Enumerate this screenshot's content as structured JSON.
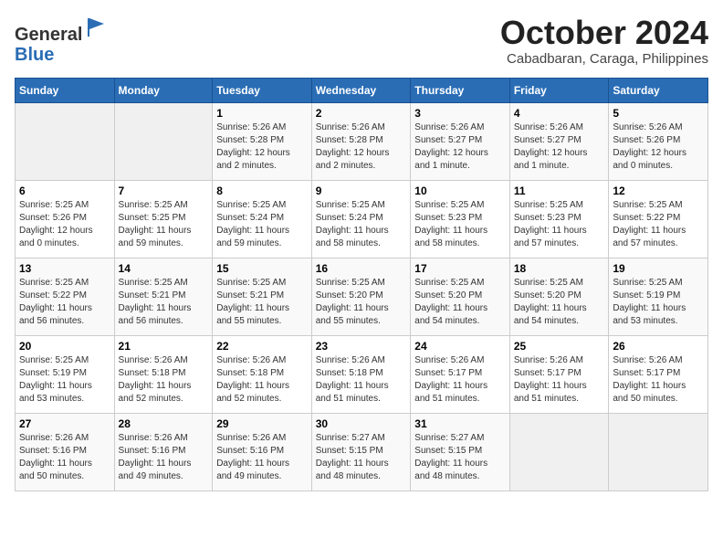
{
  "header": {
    "logo_general": "General",
    "logo_blue": "Blue",
    "month_title": "October 2024",
    "location": "Cabadbaran, Caraga, Philippines"
  },
  "weekdays": [
    "Sunday",
    "Monday",
    "Tuesday",
    "Wednesday",
    "Thursday",
    "Friday",
    "Saturday"
  ],
  "weeks": [
    [
      {
        "day": "",
        "info": ""
      },
      {
        "day": "",
        "info": ""
      },
      {
        "day": "1",
        "info": "Sunrise: 5:26 AM\nSunset: 5:28 PM\nDaylight: 12 hours\nand 2 minutes."
      },
      {
        "day": "2",
        "info": "Sunrise: 5:26 AM\nSunset: 5:28 PM\nDaylight: 12 hours\nand 2 minutes."
      },
      {
        "day": "3",
        "info": "Sunrise: 5:26 AM\nSunset: 5:27 PM\nDaylight: 12 hours\nand 1 minute."
      },
      {
        "day": "4",
        "info": "Sunrise: 5:26 AM\nSunset: 5:27 PM\nDaylight: 12 hours\nand 1 minute."
      },
      {
        "day": "5",
        "info": "Sunrise: 5:26 AM\nSunset: 5:26 PM\nDaylight: 12 hours\nand 0 minutes."
      }
    ],
    [
      {
        "day": "6",
        "info": "Sunrise: 5:25 AM\nSunset: 5:26 PM\nDaylight: 12 hours\nand 0 minutes."
      },
      {
        "day": "7",
        "info": "Sunrise: 5:25 AM\nSunset: 5:25 PM\nDaylight: 11 hours\nand 59 minutes."
      },
      {
        "day": "8",
        "info": "Sunrise: 5:25 AM\nSunset: 5:24 PM\nDaylight: 11 hours\nand 59 minutes."
      },
      {
        "day": "9",
        "info": "Sunrise: 5:25 AM\nSunset: 5:24 PM\nDaylight: 11 hours\nand 58 minutes."
      },
      {
        "day": "10",
        "info": "Sunrise: 5:25 AM\nSunset: 5:23 PM\nDaylight: 11 hours\nand 58 minutes."
      },
      {
        "day": "11",
        "info": "Sunrise: 5:25 AM\nSunset: 5:23 PM\nDaylight: 11 hours\nand 57 minutes."
      },
      {
        "day": "12",
        "info": "Sunrise: 5:25 AM\nSunset: 5:22 PM\nDaylight: 11 hours\nand 57 minutes."
      }
    ],
    [
      {
        "day": "13",
        "info": "Sunrise: 5:25 AM\nSunset: 5:22 PM\nDaylight: 11 hours\nand 56 minutes."
      },
      {
        "day": "14",
        "info": "Sunrise: 5:25 AM\nSunset: 5:21 PM\nDaylight: 11 hours\nand 56 minutes."
      },
      {
        "day": "15",
        "info": "Sunrise: 5:25 AM\nSunset: 5:21 PM\nDaylight: 11 hours\nand 55 minutes."
      },
      {
        "day": "16",
        "info": "Sunrise: 5:25 AM\nSunset: 5:20 PM\nDaylight: 11 hours\nand 55 minutes."
      },
      {
        "day": "17",
        "info": "Sunrise: 5:25 AM\nSunset: 5:20 PM\nDaylight: 11 hours\nand 54 minutes."
      },
      {
        "day": "18",
        "info": "Sunrise: 5:25 AM\nSunset: 5:20 PM\nDaylight: 11 hours\nand 54 minutes."
      },
      {
        "day": "19",
        "info": "Sunrise: 5:25 AM\nSunset: 5:19 PM\nDaylight: 11 hours\nand 53 minutes."
      }
    ],
    [
      {
        "day": "20",
        "info": "Sunrise: 5:25 AM\nSunset: 5:19 PM\nDaylight: 11 hours\nand 53 minutes."
      },
      {
        "day": "21",
        "info": "Sunrise: 5:26 AM\nSunset: 5:18 PM\nDaylight: 11 hours\nand 52 minutes."
      },
      {
        "day": "22",
        "info": "Sunrise: 5:26 AM\nSunset: 5:18 PM\nDaylight: 11 hours\nand 52 minutes."
      },
      {
        "day": "23",
        "info": "Sunrise: 5:26 AM\nSunset: 5:18 PM\nDaylight: 11 hours\nand 51 minutes."
      },
      {
        "day": "24",
        "info": "Sunrise: 5:26 AM\nSunset: 5:17 PM\nDaylight: 11 hours\nand 51 minutes."
      },
      {
        "day": "25",
        "info": "Sunrise: 5:26 AM\nSunset: 5:17 PM\nDaylight: 11 hours\nand 51 minutes."
      },
      {
        "day": "26",
        "info": "Sunrise: 5:26 AM\nSunset: 5:17 PM\nDaylight: 11 hours\nand 50 minutes."
      }
    ],
    [
      {
        "day": "27",
        "info": "Sunrise: 5:26 AM\nSunset: 5:16 PM\nDaylight: 11 hours\nand 50 minutes."
      },
      {
        "day": "28",
        "info": "Sunrise: 5:26 AM\nSunset: 5:16 PM\nDaylight: 11 hours\nand 49 minutes."
      },
      {
        "day": "29",
        "info": "Sunrise: 5:26 AM\nSunset: 5:16 PM\nDaylight: 11 hours\nand 49 minutes."
      },
      {
        "day": "30",
        "info": "Sunrise: 5:27 AM\nSunset: 5:15 PM\nDaylight: 11 hours\nand 48 minutes."
      },
      {
        "day": "31",
        "info": "Sunrise: 5:27 AM\nSunset: 5:15 PM\nDaylight: 11 hours\nand 48 minutes."
      },
      {
        "day": "",
        "info": ""
      },
      {
        "day": "",
        "info": ""
      }
    ]
  ]
}
